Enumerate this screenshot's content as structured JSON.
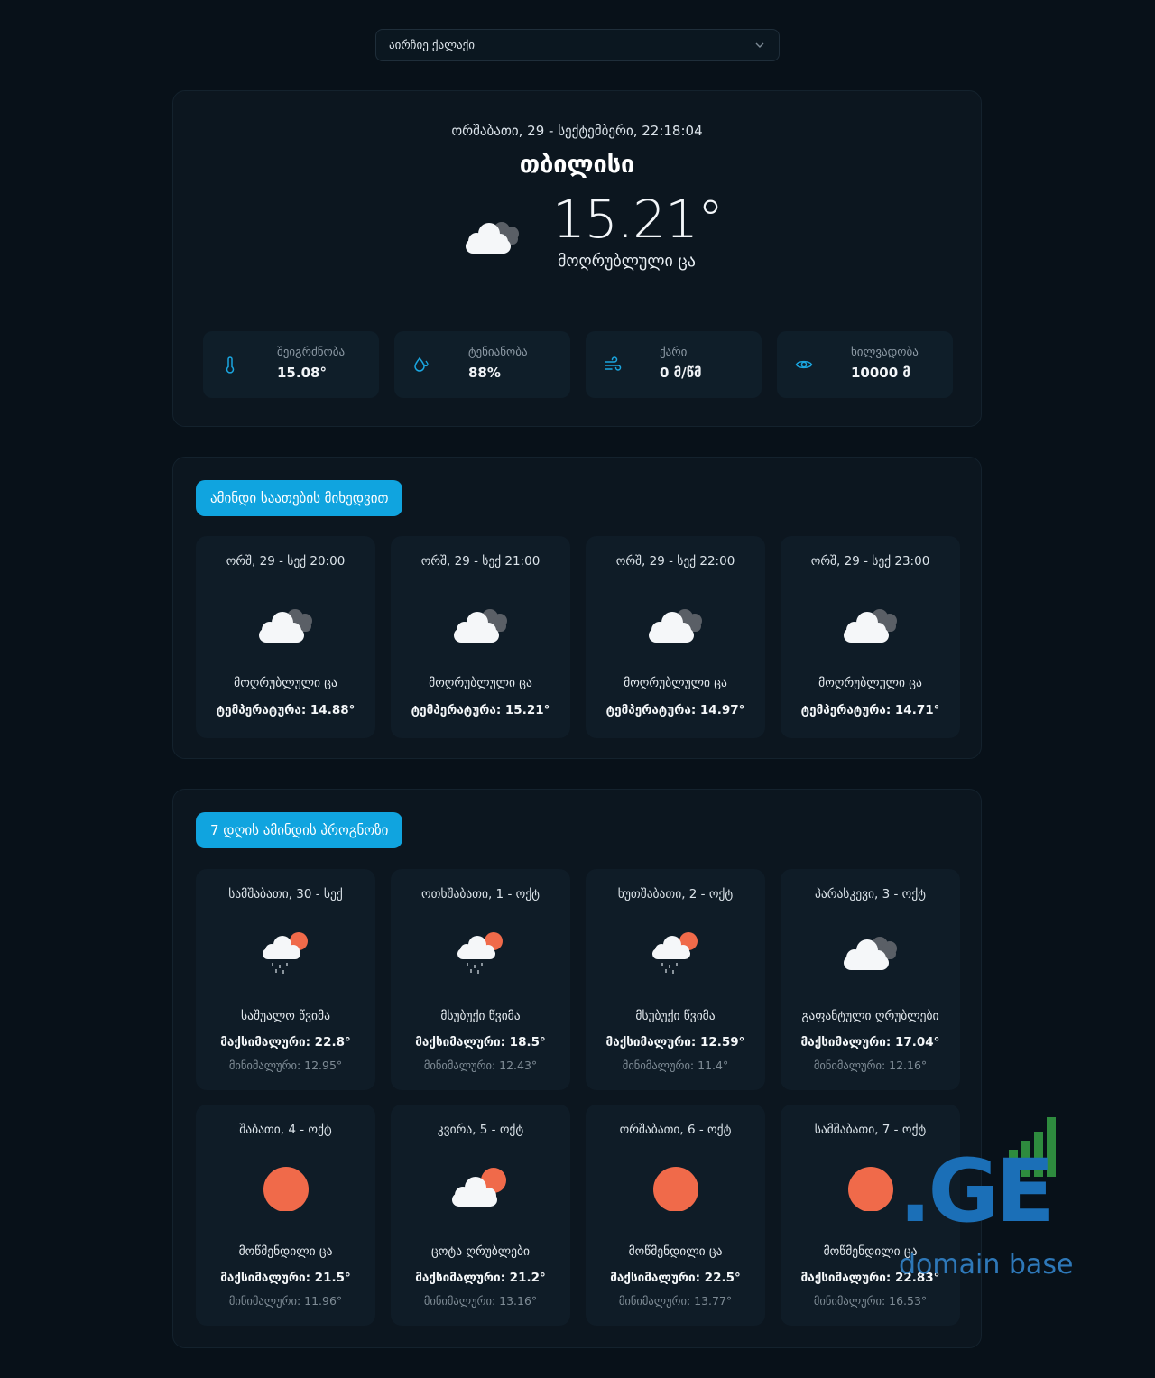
{
  "city_select": {
    "placeholder": "აირჩიე ქალაქი"
  },
  "current": {
    "datetime": "ორშაბათი, 29 - სექტემბერი, 22:18:04",
    "city": "თბილისი",
    "temp": "15.21°",
    "description": "მოღრუბლული ცა",
    "icon": "clouds-icon",
    "stats": [
      {
        "label": "შეიგრძნობა",
        "value": "15.08°",
        "icon": "thermometer-icon"
      },
      {
        "label": "ტენიანობა",
        "value": "88%",
        "icon": "humidity-icon"
      },
      {
        "label": "ქარი",
        "value": "0 მ/წმ",
        "icon": "wind-icon"
      },
      {
        "label": "ხილვადობა",
        "value": "10000 მ",
        "icon": "eye-icon"
      }
    ]
  },
  "hourly": {
    "title": "ამინდი საათების მიხედვით",
    "items": [
      {
        "time": "ორშ, 29 - სექ 20:00",
        "desc": "მოღრუბლული ცა",
        "temp": "ტემპერატურა: 14.88°",
        "icon": "clouds-icon"
      },
      {
        "time": "ორშ, 29 - სექ 21:00",
        "desc": "მოღრუბლული ცა",
        "temp": "ტემპერატურა: 15.21°",
        "icon": "clouds-icon"
      },
      {
        "time": "ორშ, 29 - სექ 22:00",
        "desc": "მოღრუბლული ცა",
        "temp": "ტემპერატურა: 14.97°",
        "icon": "clouds-icon"
      },
      {
        "time": "ორშ, 29 - სექ 23:00",
        "desc": "მოღრუბლული ცა",
        "temp": "ტემპერატურა: 14.71°",
        "icon": "clouds-icon"
      }
    ]
  },
  "daily": {
    "title": "7 დღის ამინდის პროგნოზი",
    "items": [
      {
        "day": "სამშაბათი, 30 - სექ",
        "desc": "საშუალო წვიმა",
        "max": "მაქსიმალური: 22.8°",
        "min": "მინიმალური: 12.95°",
        "icon": "rain-sun-icon"
      },
      {
        "day": "ოთხშაბათი, 1 - ოქტ",
        "desc": "მსუბუქი წვიმა",
        "max": "მაქსიმალური: 18.5°",
        "min": "მინიმალური: 12.43°",
        "icon": "rain-sun-icon"
      },
      {
        "day": "ხუთშაბათი, 2 - ოქტ",
        "desc": "მსუბუქი წვიმა",
        "max": "მაქსიმალური: 12.59°",
        "min": "მინიმალური: 11.4°",
        "icon": "rain-sun-icon"
      },
      {
        "day": "პარასკევი, 3 - ოქტ",
        "desc": "გაფანტული ღრუბლები",
        "max": "მაქსიმალური: 17.04°",
        "min": "მინიმალური: 12.16°",
        "icon": "clouds-icon"
      },
      {
        "day": "შაბათი, 4 - ოქტ",
        "desc": "მოწმენდილი ცა",
        "max": "მაქსიმალური: 21.5°",
        "min": "მინიმალური: 11.96°",
        "icon": "sun-icon"
      },
      {
        "day": "კვირა, 5 - ოქტ",
        "desc": "ცოტა ღრუბლები",
        "max": "მაქსიმალური: 21.2°",
        "min": "მინიმალური: 13.16°",
        "icon": "sun-cloud-icon"
      },
      {
        "day": "ორშაბათი, 6 - ოქტ",
        "desc": "მოწმენდილი ცა",
        "max": "მაქსიმალური: 22.5°",
        "min": "მინიმალური: 13.77°",
        "icon": "sun-icon"
      },
      {
        "day": "სამშაბათი, 7 - ოქტ",
        "desc": "მოწმენდილი ცა",
        "max": "მაქსიმალური: 22.83°",
        "min": "მინიმალური: 16.53°",
        "icon": "sun-icon"
      }
    ]
  },
  "watermark": {
    "brand": ".GE",
    "subtitle": "domain base"
  },
  "colors": {
    "accent": "#10a4df",
    "background": "#081119",
    "sun": "#f06a4a"
  }
}
